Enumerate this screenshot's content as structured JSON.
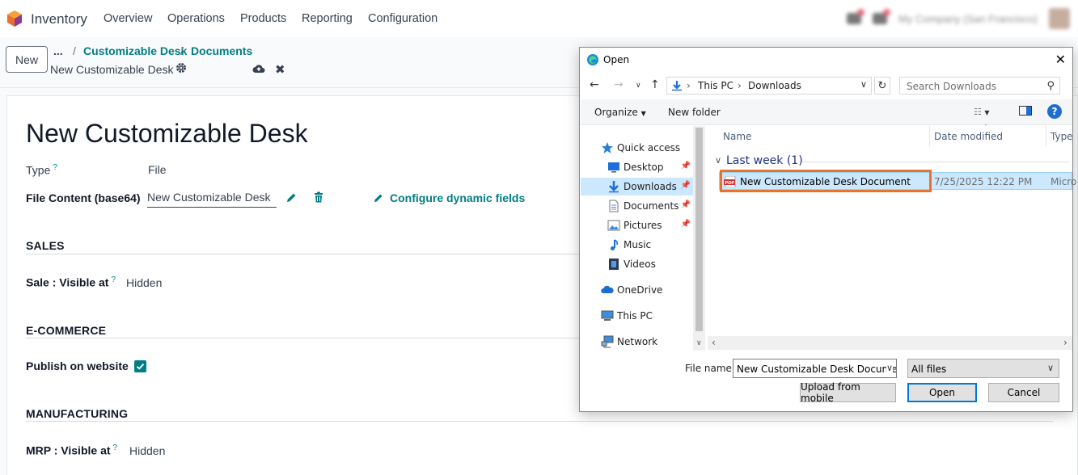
{
  "topbar": {
    "app_name": "Inventory",
    "menu": [
      "Overview",
      "Operations",
      "Products",
      "Reporting",
      "Configuration"
    ],
    "company": "My Company (San Francisco)"
  },
  "control_panel": {
    "new_label": "New",
    "breadcrumb_more": "...",
    "breadcrumbs": [
      "Customizable Desk",
      "Documents"
    ],
    "record_name": "New Customizable Desk"
  },
  "form": {
    "title": "New Customizable Desk",
    "type_label": "Type",
    "type_value": "File",
    "help_mark": "?",
    "file_content_label": "File Content (base64)",
    "file_content_value": "New Customizable Desk",
    "configure_label": "Configure dynamic fields",
    "sales": {
      "title": "SALES",
      "field_label": "Sale : Visible at",
      "field_value": "Hidden"
    },
    "ecommerce": {
      "title": "E-COMMERCE",
      "field_label": "Publish on website",
      "checked": true
    },
    "manufacturing": {
      "title": "MANUFACTURING",
      "field_label": "MRP : Visible at",
      "field_value": "Hidden"
    }
  },
  "dialog": {
    "title": "Open",
    "address": [
      "This PC",
      "Downloads"
    ],
    "search_placeholder": "Search Downloads",
    "organize_label": "Organize",
    "new_folder_label": "New folder",
    "help_label": "?",
    "nav_items": [
      {
        "label": "Quick access",
        "icon": "star-icon",
        "level": "top"
      },
      {
        "label": "Desktop",
        "icon": "desktop-icon",
        "pinned": true
      },
      {
        "label": "Downloads",
        "icon": "download-icon",
        "pinned": true,
        "selected": true
      },
      {
        "label": "Documents",
        "icon": "document-icon",
        "pinned": true
      },
      {
        "label": "Pictures",
        "icon": "pictures-icon",
        "pinned": true
      },
      {
        "label": "Music",
        "icon": "music-icon"
      },
      {
        "label": "Videos",
        "icon": "videos-icon"
      },
      {
        "label": "OneDrive",
        "icon": "cloud-icon",
        "level": "top"
      },
      {
        "label": "This PC",
        "icon": "computer-icon",
        "level": "top"
      },
      {
        "label": "Network",
        "icon": "network-icon",
        "level": "top"
      }
    ],
    "columns": [
      "Name",
      "Date modified",
      "Type"
    ],
    "group_label": "Last week (1)",
    "files": [
      {
        "name": "New Customizable Desk Document",
        "date": "7/25/2025 12:22 PM",
        "type": "Micro"
      }
    ],
    "file_name_label": "File name:",
    "file_name_value": "New Customizable Desk Documen",
    "file_type_value": "All files",
    "upload_label": "Upload from mobile",
    "open_label": "Open",
    "cancel_label": "Cancel"
  },
  "colors": {
    "accent": "#017e84",
    "selection": "#cce8ff",
    "highlight": "#e8742b",
    "win_blue": "#0078d7"
  }
}
